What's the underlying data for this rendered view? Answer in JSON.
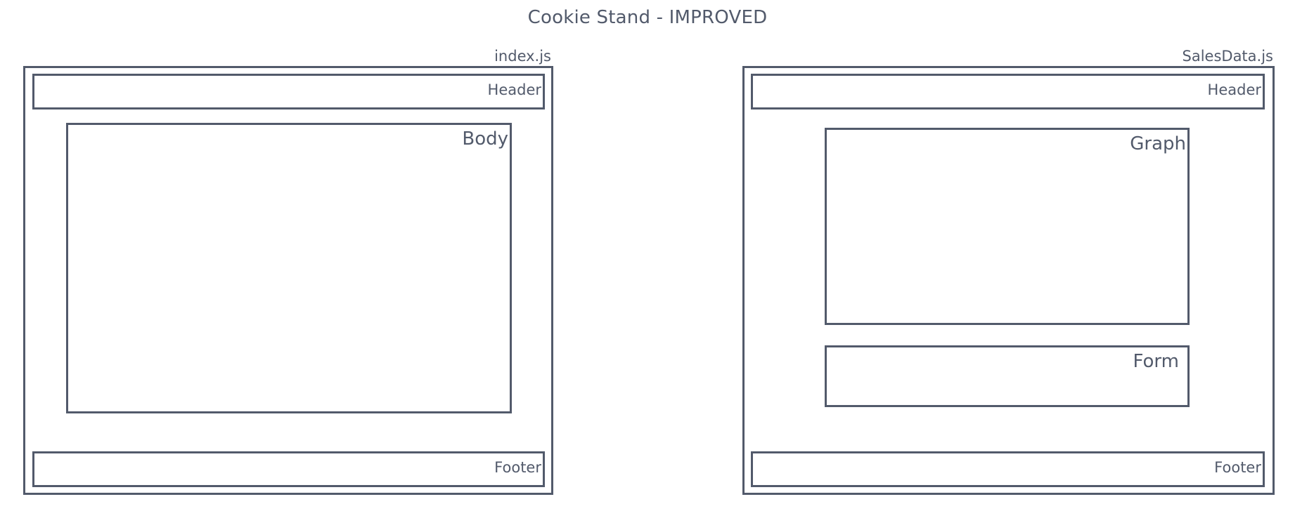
{
  "title": "Cookie Stand - IMPROVED",
  "diagrams": [
    {
      "file": "index.js",
      "sections": {
        "header": "Header",
        "body": "Body",
        "footer": "Footer"
      }
    },
    {
      "file": "SalesData.js",
      "sections": {
        "header": "Header",
        "graph": "Graph",
        "form": "Form",
        "footer": "Footer"
      }
    }
  ],
  "colors": {
    "stroke": "#525a6b",
    "background": "#ffffff"
  }
}
